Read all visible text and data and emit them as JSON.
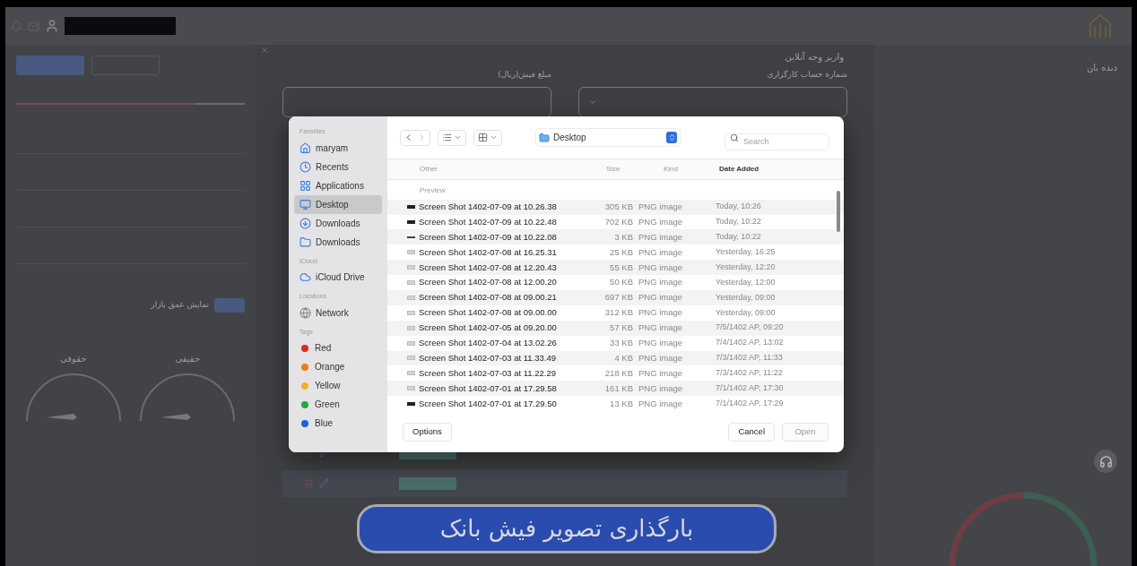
{
  "app": {
    "modal": {
      "title": "واریز وجه آنلاین",
      "account_label": "شماره حساب کارگزاری",
      "amount_label": "مبلغ فیش(ریال)"
    },
    "watch_title": "دیده بان",
    "depth_label": "نمایش عمق بازار",
    "depth_slider": {
      "level": 0.78
    },
    "depth_toggle": {
      "on": true
    },
    "gauges": [
      "حقیقی",
      "حقوقی"
    ]
  },
  "file_dialog": {
    "location": "Desktop",
    "search_placeholder": "Search",
    "sidebar": [
      {
        "heading": "Favorites",
        "items": [
          {
            "label": "maryam",
            "selected": false
          },
          {
            "label": "Recents",
            "selected": false
          },
          {
            "label": "Applications",
            "selected": false
          },
          {
            "label": "Desktop",
            "selected": true
          },
          {
            "label": "Downloads",
            "selected": false
          },
          {
            "label": "Downloads",
            "selected": false
          }
        ]
      },
      {
        "heading": "iCloud",
        "items": [
          {
            "label": "iCloud Drive",
            "selected": false
          }
        ]
      },
      {
        "heading": "Locations",
        "items": [
          {
            "label": "Network",
            "selected": false
          }
        ]
      },
      {
        "heading": "Tags",
        "items": [
          {
            "label": "Red",
            "color": "#e0261f",
            "selected": false
          },
          {
            "label": "Orange",
            "color": "#ef7a1c",
            "selected": false
          },
          {
            "label": "Yellow",
            "color": "#eeb22c",
            "selected": false
          },
          {
            "label": "Green",
            "color": "#27a83a",
            "selected": false
          },
          {
            "label": "Blue",
            "color": "#1f5fe0",
            "selected": false
          }
        ]
      }
    ],
    "columns": [
      {
        "label": "Other",
        "sorted": false
      },
      {
        "label": "Size",
        "sorted": false
      },
      {
        "label": "Kind",
        "sorted": false
      },
      {
        "label": "Date Added",
        "sorted": true
      }
    ],
    "group_label": "Preview",
    "files": [
      {
        "name": "Screen Shot 1402-07-09 at 10.26.38",
        "size": "305 KB",
        "kind": "PNG image",
        "date": "Today, 10:26"
      },
      {
        "name": "Screen Shot 1402-07-09 at 10.22.48",
        "size": "702 KB",
        "kind": "PNG image",
        "date": "Today, 10:22"
      },
      {
        "name": "Screen Shot 1402-07-09 at 10.22.08",
        "size": "3 KB",
        "kind": "PNG image",
        "date": "Today, 10:22"
      },
      {
        "name": "Screen Shot 1402-07-08 at 16.25.31",
        "size": "25 KB",
        "kind": "PNG image",
        "date": "Yesterday, 16:25"
      },
      {
        "name": "Screen Shot 1402-07-08 at 12.20.43",
        "size": "55 KB",
        "kind": "PNG image",
        "date": "Yesterday, 12:20"
      },
      {
        "name": "Screen Shot 1402-07-08 at 12.00.20",
        "size": "50 KB",
        "kind": "PNG image",
        "date": "Yesterday, 12:00"
      },
      {
        "name": "Screen Shot 1402-07-08 at 09.00.21",
        "size": "697 KB",
        "kind": "PNG image",
        "date": "Yesterday, 09:00"
      },
      {
        "name": "Screen Shot 1402-07-08 at 09.00.00",
        "size": "312 KB",
        "kind": "PNG image",
        "date": "Yesterday, 09:00"
      },
      {
        "name": "Screen Shot 1402-07-05 at 09.20.00",
        "size": "57 KB",
        "kind": "PNG image",
        "date": "7/5/1402 AP, 09:20"
      },
      {
        "name": "Screen Shot 1402-07-04 at 13.02.26",
        "size": "33 KB",
        "kind": "PNG image",
        "date": "7/4/1402 AP, 13:02"
      },
      {
        "name": "Screen Shot 1402-07-03 at 11.33.49",
        "size": "4 KB",
        "kind": "PNG image",
        "date": "7/3/1402 AP, 11:33"
      },
      {
        "name": "Screen Shot 1402-07-03 at 11.22.29",
        "size": "218 KB",
        "kind": "PNG image",
        "date": "7/3/1402 AP, 11:22"
      },
      {
        "name": "Screen Shot 1402-07-01 at 17.29.58",
        "size": "161 KB",
        "kind": "PNG image",
        "date": "7/1/1402 AP, 17:30"
      },
      {
        "name": "Screen Shot 1402-07-01 at 17.29.50",
        "size": "13 KB",
        "kind": "PNG image",
        "date": "7/1/1402 AP, 17:29"
      }
    ],
    "buttons": [
      {
        "label": "Options",
        "kind": "secondary",
        "disabled": false
      },
      {
        "label": "Cancel",
        "kind": "secondary",
        "disabled": false
      },
      {
        "label": "Open",
        "kind": "primary",
        "disabled": true
      }
    ]
  },
  "caption": "بارگذاری تصویر فیش بانک"
}
